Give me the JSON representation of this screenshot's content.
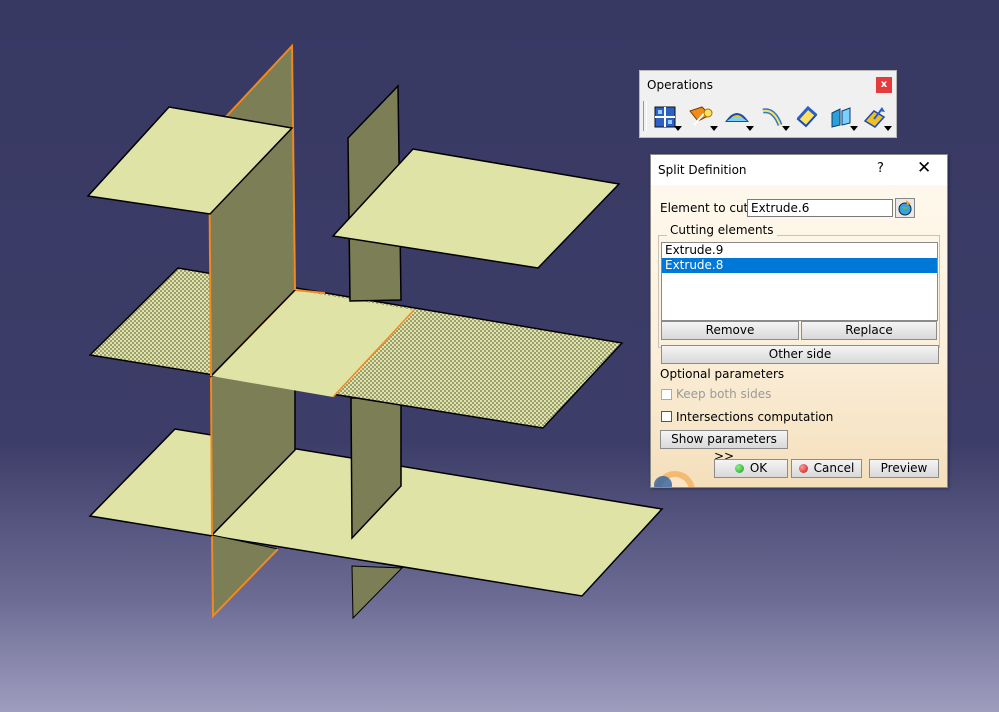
{
  "operations": {
    "title": "Operations",
    "close_label": "x",
    "tools": [
      {
        "name": "join-icon",
        "color": "#2a60c8"
      },
      {
        "name": "split-icon",
        "color": "#f08c1c"
      },
      {
        "name": "fill-icon",
        "color": "#e8c820"
      },
      {
        "name": "trim-icon",
        "color": "#2a7ad8"
      },
      {
        "name": "boundary-icon",
        "color": "#2a60c8"
      },
      {
        "name": "extract-icon",
        "color": "#2aa0d8"
      },
      {
        "name": "translate-icon",
        "color": "#f0c020"
      }
    ]
  },
  "dialog": {
    "title": "Split Definition",
    "help_label": "?",
    "close_label": "✕",
    "element_to_cut_label": "Element to cut:",
    "element_to_cut_value": "Extrude.6",
    "cutting_elements_label": "Cutting elements",
    "cutting_elements": [
      {
        "name": "Extrude.9",
        "selected": false
      },
      {
        "name": "Extrude.8",
        "selected": true
      }
    ],
    "remove_label": "Remove",
    "replace_label": "Replace",
    "other_side_label": "Other side",
    "optional_parameters_label": "Optional parameters",
    "keep_both_sides_label": "Keep both sides",
    "intersections_label": "Intersections computation",
    "show_parameters_label": "Show parameters >>",
    "ok_label": "OK",
    "cancel_label": "Cancel",
    "preview_label": "Preview"
  },
  "colors": {
    "plane_fill": "#dfe3a6",
    "vertical_fill": "#7c7e55",
    "highlight": "#f08a20",
    "selection": "#0078d7"
  }
}
